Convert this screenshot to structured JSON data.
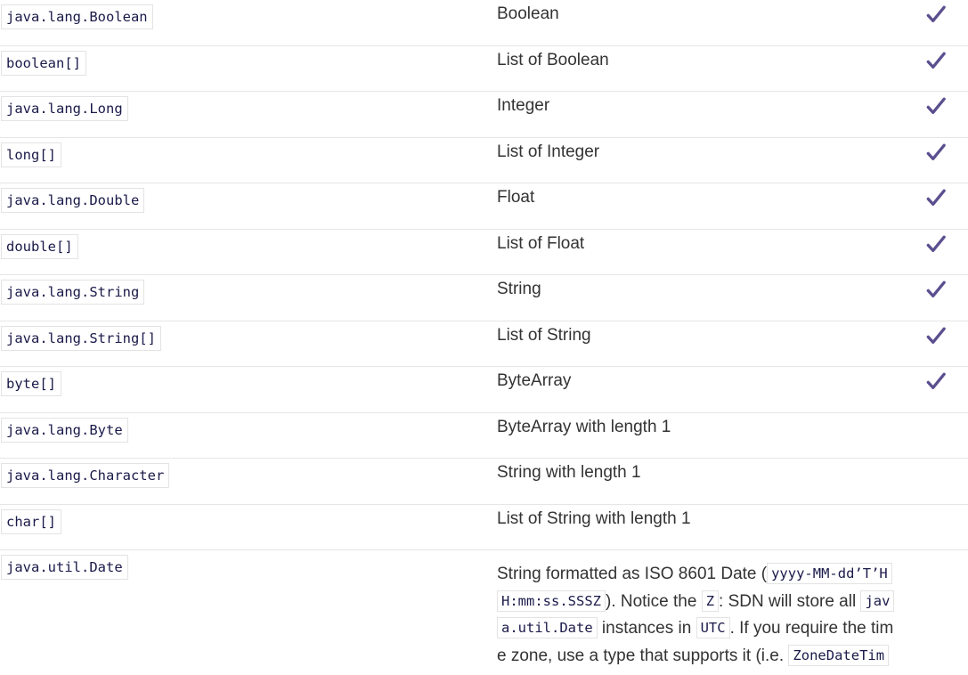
{
  "rows": [
    {
      "java": "java.lang.Boolean",
      "type": "Boolean",
      "supported": true
    },
    {
      "java": "boolean[]",
      "type": "List of Boolean",
      "supported": true
    },
    {
      "java": "java.lang.Long",
      "type": "Integer",
      "supported": true
    },
    {
      "java": "long[]",
      "type": "List of Integer",
      "supported": true
    },
    {
      "java": "java.lang.Double",
      "type": "Float",
      "supported": true
    },
    {
      "java": "double[]",
      "type": "List of Float",
      "supported": true
    },
    {
      "java": "java.lang.String",
      "type": "String",
      "supported": true
    },
    {
      "java": "java.lang.String[]",
      "type": "List of String",
      "supported": true
    },
    {
      "java": "byte[]",
      "type": "ByteArray",
      "supported": true
    },
    {
      "java": "java.lang.Byte",
      "type": "ByteArray with length 1",
      "supported": false
    },
    {
      "java": "java.lang.Character",
      "type": "String with length 1",
      "supported": false
    },
    {
      "java": "char[]",
      "type": "List of String with length 1",
      "supported": false
    }
  ],
  "date_row": {
    "java": "java.util.Date",
    "desc": {
      "t1": "String formatted as ISO 8601 Date (",
      "c1a": "yyyy-MM-dd’T’H",
      "c1b": "H:mm:ss.SSSZ",
      "t2": "). Notice the ",
      "c2": "Z",
      "t3": ": SDN will store all ",
      "c3a": "jav",
      "c3b": "a.util.Date",
      "t4": " instances in ",
      "c4": "UTC",
      "t5a": ". If you require the tim",
      "t5b": "e zone, use a type that supports it (i.e. ",
      "c5": "ZoneDateTim"
    }
  },
  "colors": {
    "check": "#5b4f8f",
    "code_text": "#1a1a4a",
    "border": "#e6e6e6"
  },
  "icons": {
    "check": "check-icon"
  }
}
